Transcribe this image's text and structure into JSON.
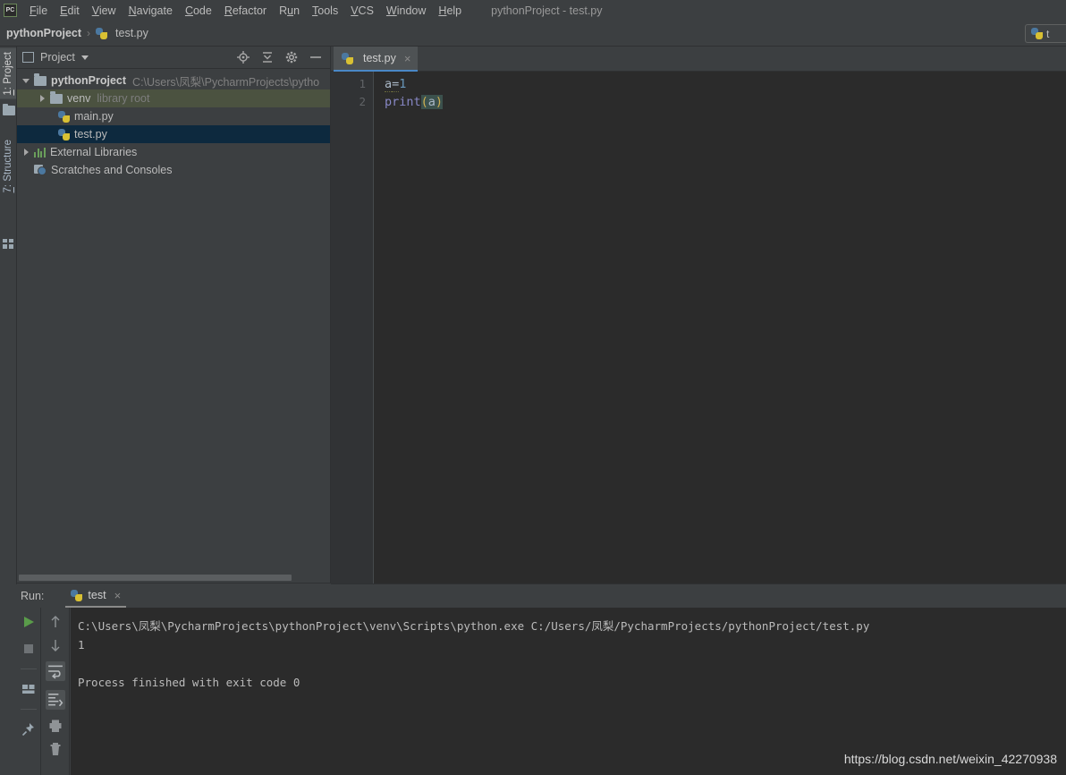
{
  "window": {
    "title": "pythonProject - test.py",
    "logo_text": "PC",
    "logo_name": "pycharm-logo-icon"
  },
  "menu": {
    "items": [
      {
        "mnemonic": "F",
        "rest": "ile"
      },
      {
        "mnemonic": "E",
        "rest": "dit"
      },
      {
        "mnemonic": "V",
        "rest": "iew"
      },
      {
        "mnemonic": "N",
        "rest": "avigate"
      },
      {
        "mnemonic": "C",
        "rest": "ode"
      },
      {
        "mnemonic": "R",
        "rest": "efactor"
      },
      {
        "mnemonic": "R",
        "rest": "un",
        "pre": "R",
        "mid": "u",
        "post": "n"
      },
      {
        "mnemonic": "T",
        "rest": "ools"
      },
      {
        "mnemonic": "V",
        "rest": "CS"
      },
      {
        "mnemonic": "W",
        "rest": "indow"
      },
      {
        "mnemonic": "H",
        "rest": "elp"
      }
    ]
  },
  "breadcrumb": {
    "project": "pythonProject",
    "separator": "›",
    "file": "test.py"
  },
  "run_config": {
    "label": "t"
  },
  "left_strip": {
    "project_tab_mnemonic": "1",
    "project_tab_label": ": Project",
    "structure_tab_mnemonic": "7",
    "structure_tab_label": ": Structure"
  },
  "project_panel": {
    "title": "Project",
    "tools": [
      "locate-target-icon",
      "collapse-all-icon",
      "gear-icon",
      "minimize-icon"
    ],
    "tree": [
      {
        "label": "pythonProject",
        "detail": "C:\\Users\\凤梨\\PycharmProjects\\pytho",
        "indent": 0,
        "arrow": "open",
        "icon": "folder-icon",
        "bold": true,
        "state": "normal"
      },
      {
        "label": "venv",
        "detail": "library root",
        "indent": 1,
        "arrow": "closed",
        "icon": "folder-icon",
        "bold": false,
        "state": "venv"
      },
      {
        "label": "main.py",
        "detail": "",
        "indent": 2,
        "arrow": "none",
        "icon": "python-file-icon",
        "bold": false,
        "state": "normal"
      },
      {
        "label": "test.py",
        "detail": "",
        "indent": 2,
        "arrow": "none",
        "icon": "python-file-icon",
        "bold": false,
        "state": "selected"
      },
      {
        "label": "External Libraries",
        "detail": "",
        "indent": 0,
        "arrow": "closed",
        "icon": "libraries-icon",
        "bold": false,
        "state": "normal"
      },
      {
        "label": "Scratches and Consoles",
        "detail": "",
        "indent": 0,
        "arrow": "none",
        "icon": "scratches-icon",
        "bold": false,
        "state": "normal"
      }
    ]
  },
  "editor": {
    "tab": {
      "label": "test.py",
      "icon": "python-file-icon",
      "close": "×"
    },
    "line_numbers": [
      "1",
      "2"
    ],
    "code": {
      "line1": {
        "var": "a",
        "eq": "=",
        "num": "1"
      },
      "line2": {
        "fn": "print",
        "open": "(",
        "arg": "a",
        "close": ")"
      }
    }
  },
  "run_panel": {
    "label": "Run:",
    "tab_label": "test",
    "tab_close": "×",
    "left_tools": [
      "run-icon",
      "stop-icon",
      "layout-icon",
      "pin-icon"
    ],
    "right_tools": [
      "arrow-up-icon",
      "arrow-down-icon",
      "soft-wrap-icon",
      "scroll-to-end-icon",
      "print-icon",
      "trash-icon"
    ],
    "console": [
      "C:\\Users\\凤梨\\PycharmProjects\\pythonProject\\venv\\Scripts\\python.exe C:/Users/凤梨/PycharmProjects/pythonProject/test.py",
      "1",
      "",
      "Process finished with exit code 0"
    ]
  },
  "watermark": "https://blog.csdn.net/weixin_42270938",
  "colors": {
    "bg_chrome": "#3c3f41",
    "bg_editor": "#2b2b2b",
    "gutter": "#313335",
    "selection": "#0d293e",
    "venv_highlight": "#4b5240",
    "tab_underline": "#4a88c7",
    "run_green": "#5a9c4a",
    "keyword": "#8888c6",
    "number": "#6897bb",
    "paren": "#d0b050"
  }
}
